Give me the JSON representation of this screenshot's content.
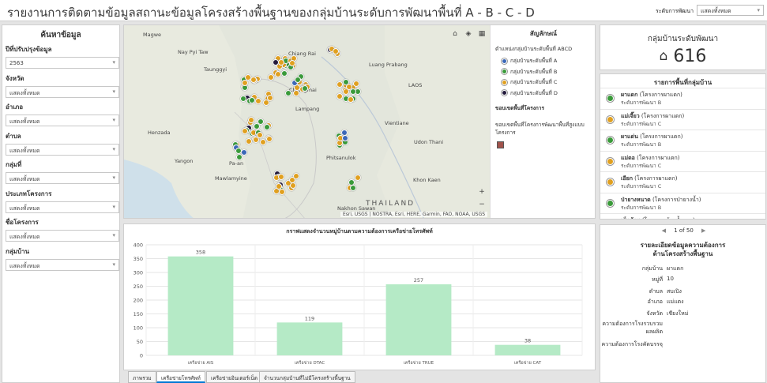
{
  "header": {
    "title": "รายงานการติดตามข้อมูลสถานะข้อมูลโครงสร้างพื้นฐานของกลุ่มบ้านระดับการพัฒนาพื้นที่ A - B - C - D",
    "level_label": "ระดับการพัฒนา",
    "level_value": "แสดงทั้งหมด"
  },
  "filters": {
    "title": "ค้นหาข้อมูล",
    "items": [
      {
        "label": "ปีที่ปรับปรุงข้อมูล",
        "value": "2563"
      },
      {
        "label": "จังหวัด",
        "value": "แสดงทั้งหมด"
      },
      {
        "label": "อำเภอ",
        "value": "แสดงทั้งหมด"
      },
      {
        "label": "ตำบล",
        "value": "แสดงทั้งหมด"
      },
      {
        "label": "กลุ่มที่",
        "value": "แสดงทั้งหมด"
      },
      {
        "label": "ประเภทโครงการ",
        "value": "แสดงทั้งหมด"
      },
      {
        "label": "ชื่อโครงการ",
        "value": "แสดงทั้งหมด"
      },
      {
        "label": "กลุ่มบ้าน",
        "value": "แสดงทั้งหมด"
      }
    ]
  },
  "map": {
    "place_labels": [
      {
        "text": "Magwe"
      },
      {
        "text": "Nay Pyi Taw"
      },
      {
        "text": "Chiang Rai"
      },
      {
        "text": "Taunggyi"
      },
      {
        "text": "Luang Prabang"
      },
      {
        "text": "Chiangmai"
      },
      {
        "text": "LAOS"
      },
      {
        "text": "Lampang"
      },
      {
        "text": "Vientiane"
      },
      {
        "text": "Henzada"
      },
      {
        "text": "Udon Thani"
      },
      {
        "text": "Yangon"
      },
      {
        "text": "Pa-an"
      },
      {
        "text": "Phitsanulok"
      },
      {
        "text": "Mawlamyine"
      },
      {
        "text": "Khon Kaen"
      },
      {
        "text": "THAILAND"
      },
      {
        "text": "Nakhon Sawan"
      }
    ],
    "attribution": "Esri, USGS | NOSTRA, Esri, HERE, Garmin, FAO, NOAA, USGS",
    "zoom_in": "+",
    "zoom_out": "−",
    "home_icon": "⌂",
    "layers_icon": "◈",
    "basemap_icon": "▦"
  },
  "legend": {
    "title": "สัญลักษณ์",
    "subtitle": "ตำแหน่งกลุ่มบ้านระดับพื้นที่ ABCD",
    "items": [
      {
        "label": "กลุ่มบ้านระดับพื้นที่ A",
        "color": "#3b67b8"
      },
      {
        "label": "กลุ่มบ้านระดับพื้นที่ B",
        "color": "#3a9a3a"
      },
      {
        "label": "กลุ่มบ้านระดับพื้นที่ C",
        "color": "#e0a020"
      },
      {
        "label": "กลุ่มบ้านระดับพื้นที่ D",
        "color": "#231a3c"
      }
    ],
    "boundary_title": "ขอบเขตพื้นที่โครงการ",
    "boundary_label": "ขอบเขตพื้นที่โครงการพัฒนาพื้นที่สูงแบบโครงการ",
    "boundary_color": "#a0524b"
  },
  "chart_data": {
    "type": "bar",
    "title": "กราฟแสดงจำนวนหมู่บ้านตามความต้องการเครือข่ายโทรศัพท์",
    "categories": [
      "เครือข่าย AIS",
      "เครือข่าย DTAC",
      "เครือข่าย TRUE",
      "เครือข่าย CAT"
    ],
    "values": [
      358,
      119,
      257,
      38
    ],
    "ylim": [
      0,
      400
    ],
    "yticks": [
      0,
      50,
      100,
      150,
      200,
      250,
      300,
      350,
      400
    ],
    "bar_color": "#b5eac6",
    "grid": true
  },
  "tabs": [
    {
      "label": "ภาพรวม",
      "active": false
    },
    {
      "label": "เครือข่ายโทรศัพท์",
      "active": true
    },
    {
      "label": "เครือข่ายอินเตอร์เน็ต",
      "active": false
    },
    {
      "label": "จำนวนกลุ่มบ้านที่ไม่มีโครงสร้างพื้นฐาน",
      "active": false
    }
  ],
  "kpi": {
    "title": "กลุ่มบ้านระดับพัฒนา",
    "value": "616",
    "icon": "house-icon"
  },
  "village_list": {
    "title": "รายการพื้นที่กลุ่มบ้าน",
    "items": [
      {
        "name": "ผาแดก",
        "project": "(โครงการผาแดก)",
        "level": "ระดับการพัฒนา B",
        "color": "#3a9a3a"
      },
      {
        "name": "แม่เจี๊ยว",
        "project": "(โครงการผาแดก)",
        "level": "ระดับการพัฒนา C",
        "color": "#e0a020"
      },
      {
        "name": "ผาแด่น",
        "project": "(โครงการผาแดก)",
        "level": "ระดับการพัฒนา B",
        "color": "#3a9a3a"
      },
      {
        "name": "แม่ดอ",
        "project": "(โครงการผาแดก)",
        "level": "ระดับการพัฒนา C",
        "color": "#e0a020"
      },
      {
        "name": "เอียก",
        "project": "(โครงการผาแดก)",
        "level": "ระดับการพัฒนา C",
        "color": "#e0a020"
      },
      {
        "name": "ป่ายางหนาด",
        "project": "(โครงการป่ายางน้ำ)",
        "level": "ระดับการพัฒนา B",
        "color": "#3a9a3a"
      },
      {
        "name": "เซ็กน้อย",
        "project": "(โครงการห้วยน้ำขาว)",
        "level": "",
        "color": "#e0a020"
      }
    ]
  },
  "pager": {
    "prev": "◀",
    "text": "1 of 50",
    "next": "▶"
  },
  "detail": {
    "title": "รายละเอียดข้อมูลความต้องการด้านโครงสร้างพื้นฐาน",
    "rows": [
      {
        "key": "กลุ่มบ้าน",
        "value": "ผาแดก"
      },
      {
        "key": "หมู่ที่",
        "value": "10"
      },
      {
        "key": "ตำบล",
        "value": "สบเปิง"
      },
      {
        "key": "อำเภอ",
        "value": "แม่แตง"
      },
      {
        "key": "จังหวัด",
        "value": "เชียงใหม่"
      },
      {
        "key": "ความต้องการโรงรวบรวมผลผลิต",
        "value": ""
      },
      {
        "key": "ความต้องการโรงคัดบรรจุ",
        "value": ""
      }
    ]
  }
}
